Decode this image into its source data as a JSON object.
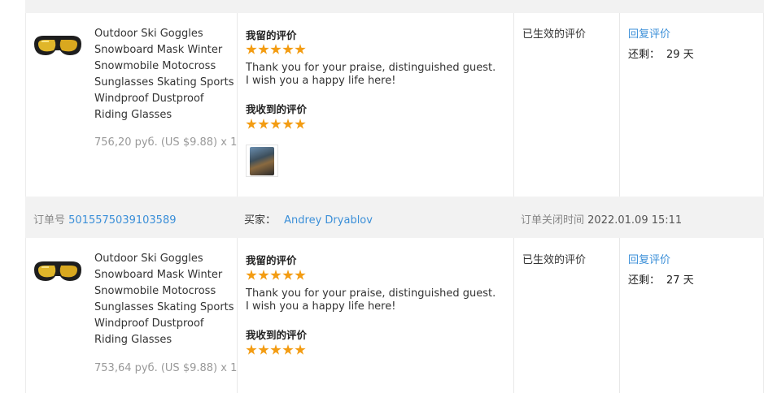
{
  "labels": {
    "my_review": "我留的评价",
    "received_review": "我收到的评价",
    "effective": "已生效的评价",
    "reply": "回复评价",
    "remaining": "还剩：",
    "order_no": "订单号",
    "buyer": "买家：",
    "close_time": "订单关闭时间"
  },
  "orders": [
    {
      "product_title": "Outdoor Ski Goggles Snowboard Mask Winter Snowmobile Motocross Sunglasses Skating Sports Windproof Dustproof Riding Glasses",
      "price": "756,20 руб. (US $9.88) x 1",
      "my_review_text": "Thank you for your praise, distinguished guest. I wish you a happy life here!",
      "my_stars": 5,
      "received_stars": 5,
      "remaining_days": "29 天",
      "has_photo": true
    },
    {
      "order_number": "5015575039103589",
      "buyer_name": "Andrey Dryablov",
      "closed_time": "2022.01.09 15:11",
      "product_title": "Outdoor Ski Goggles Snowboard Mask Winter Snowmobile Motocross Sunglasses Skating Sports Windproof Dustproof Riding Glasses",
      "price": "753,64 руб. (US $9.88) x 1",
      "my_review_text": "Thank you for your praise, distinguished guest. I wish you a happy life here!",
      "my_stars": 5,
      "received_stars": 5,
      "remaining_days": "27 天",
      "has_photo": false
    }
  ]
}
